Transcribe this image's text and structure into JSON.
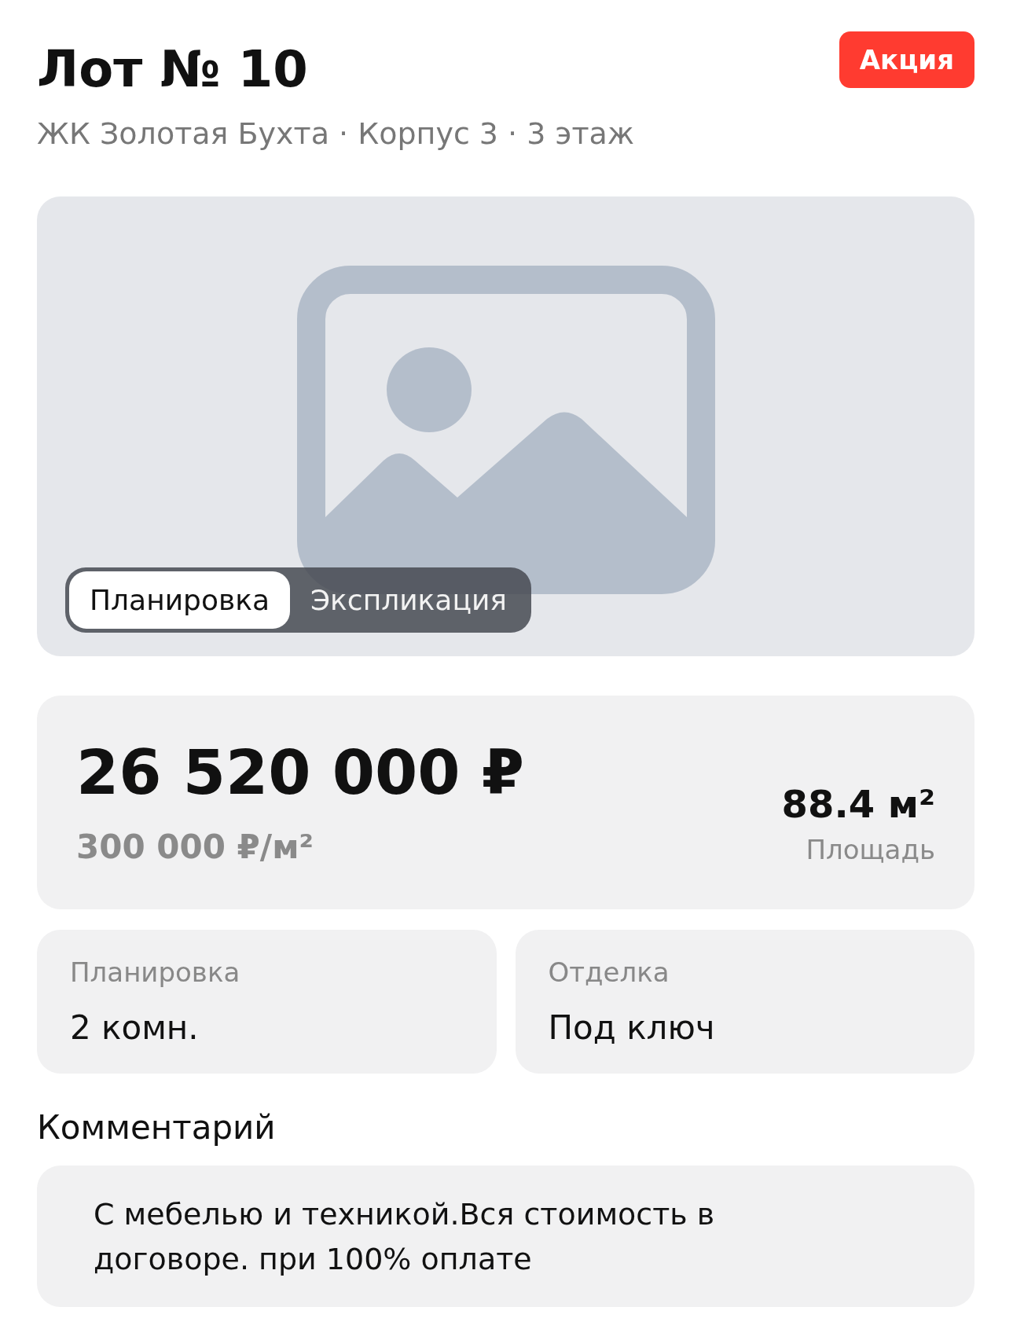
{
  "header": {
    "title": "Лот № 10",
    "badge": "Акция",
    "subtitle": "ЖК Золотая Бухта · Корпус 3 · 3 этаж"
  },
  "image": {
    "kind": "placeholder",
    "tabs": [
      {
        "label": "Планировка",
        "selected": true
      },
      {
        "label": "Экспликация",
        "selected": false
      }
    ]
  },
  "price": {
    "total": "26 520 000 ₽",
    "per_meter": "300 000 ₽/м²",
    "area": "88.4 м²",
    "area_label": "Площадь"
  },
  "details": [
    {
      "label": "Планировка",
      "value": "2 комн."
    },
    {
      "label": "Отделка",
      "value": "Под ключ"
    }
  ],
  "comment": {
    "heading": "Комментарий",
    "text": "С мебелью и техникой.Вся стоимость в договоре. при 100% оплате"
  }
}
